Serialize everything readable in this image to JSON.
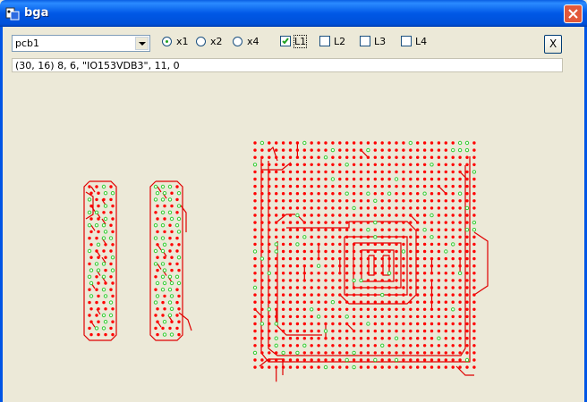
{
  "window": {
    "title": "bga",
    "app_icon": "bga-app-icon",
    "close_icon": "close-icon"
  },
  "toolbar": {
    "pcb_select": {
      "value": "pcb1"
    },
    "zoom": [
      {
        "label": "x1",
        "selected": true
      },
      {
        "label": "x2",
        "selected": false
      },
      {
        "label": "x4",
        "selected": false
      }
    ],
    "layers": [
      {
        "label": "L1",
        "checked": true
      },
      {
        "label": "L2",
        "checked": false
      },
      {
        "label": "L3",
        "checked": false
      },
      {
        "label": "L4",
        "checked": false
      }
    ],
    "close_label": "X"
  },
  "status": {
    "text": "(30, 16) 8, 6, \"IO153VDB3\", 11, 0"
  },
  "colors": {
    "trace": "#e00000",
    "pad_red": "#ff0000",
    "pad_green": "#33cc33",
    "background": "#ece9d8"
  }
}
